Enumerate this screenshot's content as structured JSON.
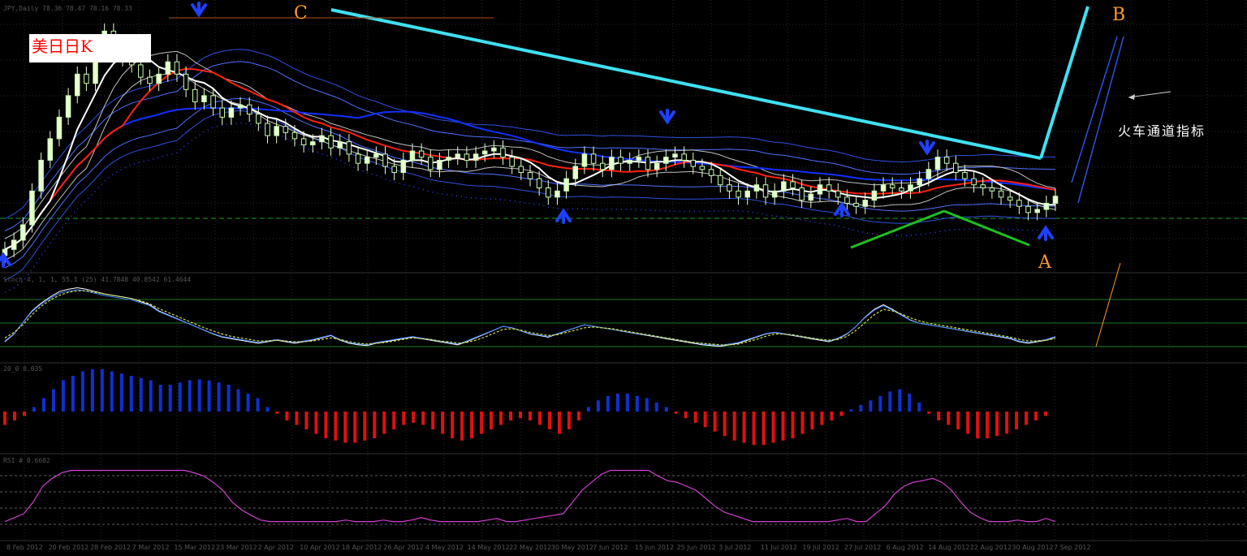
{
  "title": "美日日K",
  "symbol_header": "JPY,Daily  78.36 78.47 78.16 78.33",
  "annotation_text": "火车通道指标",
  "point_labels": {
    "a": "A",
    "b": "B",
    "c": "C"
  },
  "indicator_headers": {
    "stoch": "Stoch 4, 1, 1, 55.1 (25) 41.7848 40.8542 61.4644",
    "macd": "20_0 0.035",
    "rsi": "RSI #  0.6682"
  },
  "colors": {
    "background": "#000000",
    "bull_candle": "#e8ffd0",
    "bear_candle": "#c8ffb0",
    "ma_red": "#ff2010",
    "ma_blue": "#1030ff",
    "ma_white": "#ffffff",
    "channel_cyan": "#40e0f0",
    "support_green": "#20c020",
    "hist_pos": "#1030d0",
    "hist_neg": "#e01010",
    "rsi_line": "#d040d0",
    "label_orange": "#ff9a2e"
  },
  "x_dates": [
    "8 Feb 2012",
    "20 Feb 2012",
    "28 Feb 2012",
    "7 Mar 2012",
    "15 Mar 2012",
    "23 Mar 2012",
    "2 Apr 2012",
    "10 Apr 2012",
    "18 Apr 2012",
    "26 Apr 2012",
    "4 May 2012",
    "14 May 2012",
    "22 May 2012",
    "30 May 2012",
    "7 Jun 2012",
    "15 Jun 2012",
    "25 Jun 2012",
    "3 Jul 2012",
    "11 Jul 2012",
    "19 Jul 2012",
    "27 Jul 2012",
    "6 Aug 2012",
    "14 Aug 2012",
    "22 Aug 2012",
    "30 Aug 2012",
    "7 Sep 2012"
  ],
  "chart_data": [
    {
      "type": "candlestick",
      "title": "美日日K",
      "series": [
        {
          "name": "close",
          "values": [
            76.6,
            76.9,
            77.4,
            78.5,
            79.5,
            80.2,
            80.9,
            81.6,
            82.3,
            82.0,
            83.0,
            83.7,
            83.3,
            82.8,
            82.6,
            82.2,
            82.0,
            82.3,
            82.7,
            82.3,
            81.8,
            81.4,
            81.6,
            81.2,
            80.9,
            81.2,
            81.3,
            81.0,
            80.7,
            80.3,
            80.6,
            80.4,
            80.2,
            80.0,
            80.1,
            80.3,
            79.9,
            80.1,
            79.7,
            79.4,
            79.6,
            79.7,
            79.3,
            79.1,
            79.5,
            79.8,
            79.6,
            79.2,
            79.5,
            79.6,
            79.7,
            79.5,
            79.7,
            79.8,
            79.9,
            79.6,
            79.3,
            79.1,
            78.9,
            78.6,
            78.3,
            78.5,
            78.9,
            79.3,
            79.7,
            79.4,
            79.2,
            79.6,
            79.4,
            79.5,
            79.6,
            79.2,
            79.4,
            79.6,
            79.7,
            79.5,
            79.3,
            79.2,
            79.0,
            78.7,
            78.5,
            78.3,
            78.5,
            78.7,
            78.3,
            78.5,
            78.8,
            78.6,
            78.2,
            78.4,
            78.7,
            78.5,
            78.3,
            78.1,
            78.0,
            78.2,
            78.5,
            78.7,
            78.6,
            78.5,
            78.7,
            78.9,
            79.2,
            79.6,
            79.4,
            79.1,
            78.9,
            78.7,
            78.6,
            78.5,
            78.3,
            78.2,
            78.0,
            77.8,
            77.9,
            78.1,
            78.33
          ]
        }
      ],
      "annotations": [
        "A",
        "B",
        "C"
      ],
      "ylim": [
        76.0,
        84.5
      ]
    },
    {
      "type": "line",
      "title": "Stoch",
      "series": [
        {
          "name": "main",
          "values": [
            20,
            30,
            45,
            60,
            70,
            78,
            85,
            88,
            90,
            88,
            85,
            82,
            80,
            78,
            76,
            72,
            68,
            60,
            55,
            50,
            45,
            40,
            35,
            30,
            26,
            24,
            22,
            20,
            18,
            20,
            22,
            20,
            18,
            20,
            22,
            25,
            28,
            22,
            18,
            16,
            15,
            18,
            20,
            22,
            24,
            26,
            24,
            22,
            20,
            18,
            16,
            20,
            25,
            30,
            35,
            40,
            38,
            34,
            30,
            28,
            26,
            30,
            34,
            38,
            42,
            40,
            38,
            36,
            34,
            32,
            30,
            28,
            26,
            24,
            22,
            20,
            18,
            16,
            15,
            14,
            16,
            18,
            22,
            26,
            30,
            32,
            30,
            28,
            26,
            24,
            22,
            20,
            24,
            30,
            40,
            52,
            62,
            68,
            62,
            55,
            48,
            44,
            42,
            40,
            38,
            36,
            34,
            32,
            30,
            28,
            26,
            24,
            20,
            18,
            20,
            22,
            26
          ]
        },
        {
          "name": "signal",
          "values": [
            25,
            32,
            42,
            55,
            66,
            74,
            80,
            84,
            86,
            86,
            84,
            82,
            80,
            78,
            76,
            73,
            69,
            63,
            58,
            53,
            48,
            43,
            38,
            34,
            30,
            27,
            25,
            23,
            21,
            21,
            22,
            21,
            20,
            20,
            21,
            23,
            25,
            23,
            20,
            18,
            17,
            18,
            19,
            21,
            23,
            25,
            24,
            23,
            21,
            20,
            18,
            19,
            22,
            26,
            31,
            36,
            37,
            35,
            32,
            30,
            28,
            29,
            32,
            35,
            38,
            39,
            38,
            37,
            35,
            33,
            31,
            29,
            27,
            25,
            23,
            21,
            19,
            18,
            17,
            16,
            16,
            17,
            20,
            23,
            27,
            30,
            30,
            29,
            27,
            25,
            23,
            22,
            23,
            27,
            35,
            45,
            55,
            62,
            60,
            56,
            51,
            47,
            44,
            42,
            40,
            38,
            36,
            34,
            32,
            30,
            28,
            26,
            23,
            21,
            21,
            22,
            24
          ]
        }
      ],
      "ylim": [
        0,
        100
      ]
    },
    {
      "type": "bar",
      "title": "MACD histogram",
      "values": [
        -0.3,
        -0.2,
        -0.1,
        0.1,
        0.3,
        0.5,
        0.7,
        0.8,
        0.9,
        0.95,
        0.95,
        0.9,
        0.85,
        0.8,
        0.75,
        0.7,
        0.6,
        0.6,
        0.65,
        0.7,
        0.72,
        0.7,
        0.65,
        0.6,
        0.5,
        0.4,
        0.3,
        0.1,
        -0.05,
        -0.2,
        -0.3,
        -0.4,
        -0.5,
        -0.6,
        -0.65,
        -0.7,
        -0.7,
        -0.65,
        -0.6,
        -0.5,
        -0.4,
        -0.3,
        -0.25,
        -0.3,
        -0.4,
        -0.5,
        -0.6,
        -0.65,
        -0.6,
        -0.5,
        -0.4,
        -0.3,
        -0.2,
        -0.15,
        -0.2,
        -0.3,
        -0.4,
        -0.5,
        -0.4,
        -0.2,
        0.1,
        0.25,
        0.35,
        0.4,
        0.4,
        0.35,
        0.3,
        0.2,
        0.1,
        -0.05,
        -0.15,
        -0.25,
        -0.35,
        -0.45,
        -0.55,
        -0.65,
        -0.7,
        -0.75,
        -0.75,
        -0.7,
        -0.65,
        -0.6,
        -0.5,
        -0.4,
        -0.3,
        -0.2,
        -0.1,
        0.05,
        0.15,
        0.25,
        0.35,
        0.45,
        0.5,
        0.4,
        0.2,
        -0.05,
        -0.2,
        -0.3,
        -0.4,
        -0.5,
        -0.6,
        -0.6,
        -0.55,
        -0.5,
        -0.4,
        -0.3,
        -0.2,
        -0.1,
        0.0
      ],
      "ylim": [
        -1.0,
        1.0
      ]
    },
    {
      "type": "line",
      "title": "RSI",
      "series": [
        {
          "name": "rsi",
          "values": [
            20,
            25,
            30,
            45,
            65,
            75,
            82,
            85,
            85,
            85,
            85,
            85,
            85,
            85,
            85,
            85,
            85,
            85,
            85,
            85,
            82,
            78,
            70,
            60,
            45,
            35,
            28,
            22,
            20,
            20,
            20,
            20,
            20,
            20,
            20,
            20,
            22,
            20,
            20,
            20,
            22,
            20,
            20,
            22,
            25,
            22,
            20,
            20,
            20,
            20,
            20,
            22,
            24,
            20,
            20,
            22,
            24,
            26,
            28,
            30,
            45,
            60,
            70,
            80,
            85,
            85,
            85,
            85,
            85,
            78,
            72,
            70,
            65,
            60,
            50,
            40,
            32,
            28,
            24,
            20,
            20,
            20,
            20,
            20,
            20,
            20,
            20,
            20,
            22,
            24,
            20,
            20,
            30,
            40,
            55,
            65,
            70,
            72,
            75,
            70,
            60,
            45,
            32,
            25,
            20,
            20,
            20,
            22,
            20,
            20,
            24,
            20
          ]
        }
      ],
      "ylim": [
        0,
        100
      ]
    }
  ]
}
